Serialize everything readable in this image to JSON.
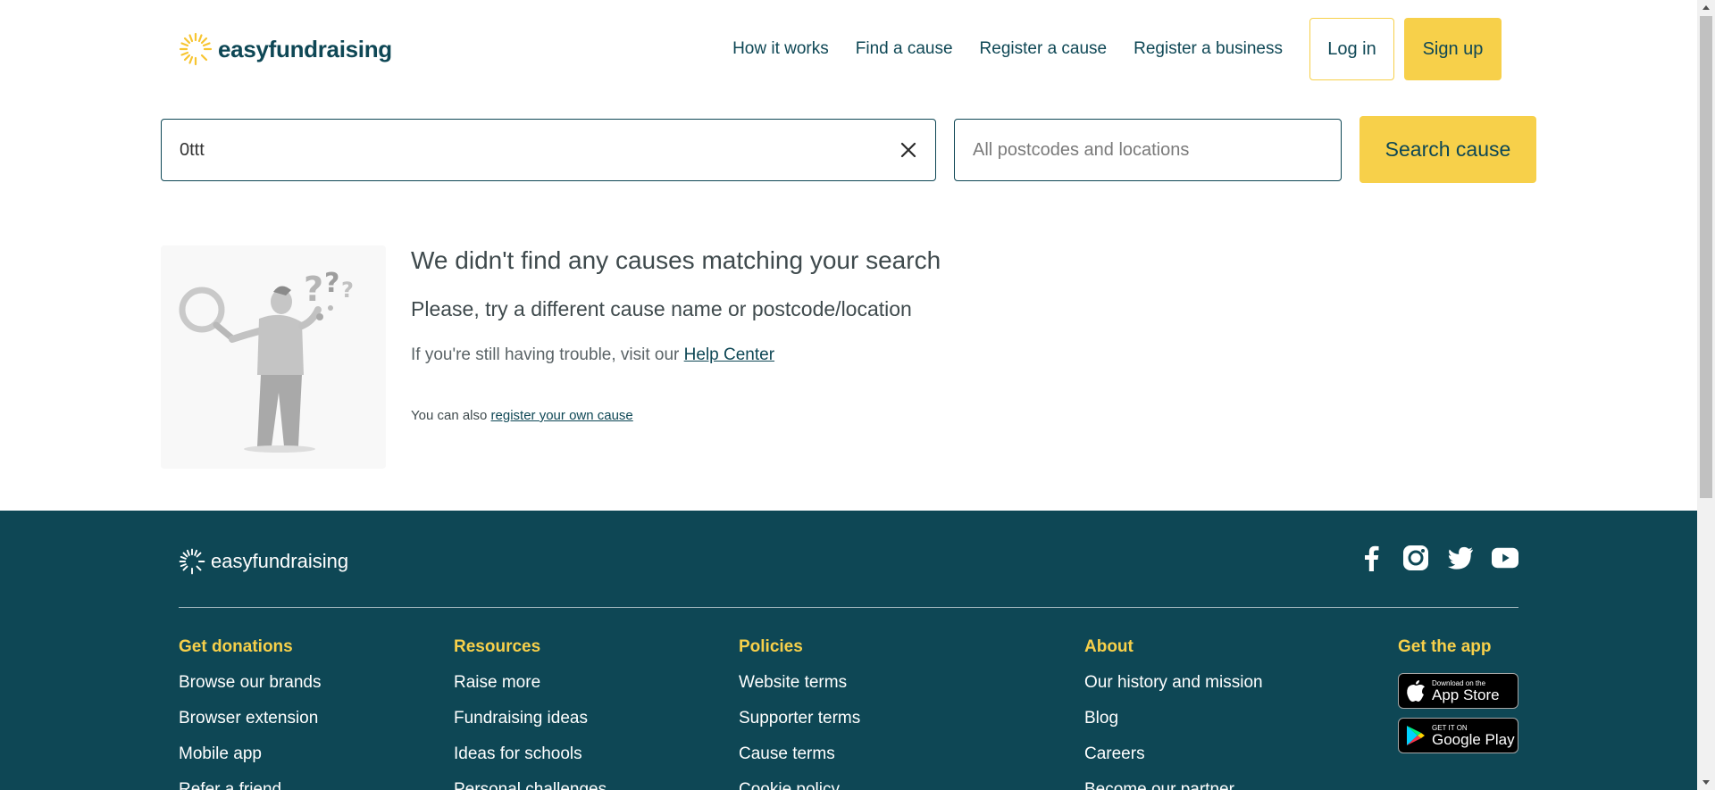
{
  "header": {
    "logo_text": "easyfundraising",
    "nav": [
      {
        "label": "How it works"
      },
      {
        "label": "Find a cause"
      },
      {
        "label": "Register a cause"
      },
      {
        "label": "Register a business"
      }
    ],
    "login_label": "Log in",
    "signup_label": "Sign up"
  },
  "search": {
    "query_value": "0ttt",
    "location_placeholder": "All postcodes and locations",
    "button_label": "Search cause"
  },
  "no_results": {
    "title": "We didn't find any causes matching your search",
    "subtitle": "Please, try a different cause name or postcode/location",
    "help_prefix": "If you're still having trouble, visit our ",
    "help_link": "Help Center",
    "register_prefix": "You can also ",
    "register_link": "register your own cause"
  },
  "footer": {
    "logo_text": "easyfundraising",
    "socials": [
      "facebook-icon",
      "instagram-icon",
      "twitter-icon",
      "youtube-icon"
    ],
    "columns": [
      {
        "heading": "Get donations",
        "items": [
          "Browse our brands",
          "Browser extension",
          "Mobile app",
          "Refer a friend"
        ]
      },
      {
        "heading": "Resources",
        "items": [
          "Raise more",
          "Fundraising ideas",
          "Ideas for schools",
          "Personal challenges"
        ]
      },
      {
        "heading": "Policies",
        "items": [
          "Website terms",
          "Supporter terms",
          "Cause terms",
          "Cookie policy"
        ]
      },
      {
        "heading": "About",
        "items": [
          "Our history and mission",
          "Blog",
          "Careers",
          "Become our partner"
        ]
      }
    ],
    "app": {
      "heading": "Get the app",
      "appstore_small": "Download on the",
      "appstore_big": "App Store",
      "googleplay_small": "GET IT ON",
      "googleplay_big": "Google Play"
    }
  },
  "colors": {
    "brand_dark": "#0e4755",
    "brand_yellow": "#f7d04a"
  }
}
